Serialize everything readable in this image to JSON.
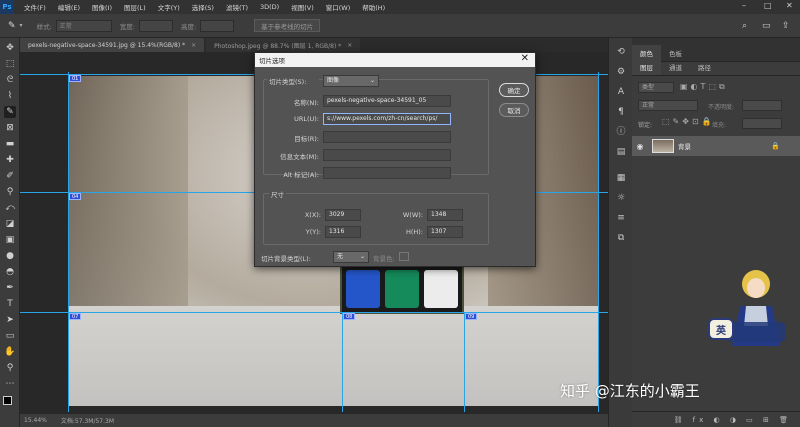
{
  "menubar": {
    "items": [
      "文件(F)",
      "编辑(E)",
      "图像(I)",
      "图层(L)",
      "文字(Y)",
      "选择(S)",
      "滤镜(T)",
      "3D(D)",
      "视图(V)",
      "窗口(W)",
      "帮助(H)"
    ],
    "logo": "Ps"
  },
  "optionsbar": {
    "style_label": "样式:",
    "style_value": "正常",
    "width_label": "宽度:",
    "height_label": "高度:",
    "guide_button": "基于参考线的切片"
  },
  "tabs": [
    {
      "label": "pexels-negative-space-34591.jpg @ 15.4%(RGB/8) *"
    },
    {
      "label": "Photoshop.jpeg @ 88.7% (图层 1, RGB/8) *"
    }
  ],
  "statusbar": {
    "zoom": "15.44%",
    "doc": "文档:57.3M/57.3M"
  },
  "slices": [
    "01",
    "04",
    "07",
    "08",
    "09"
  ],
  "panels": {
    "tabs_top": [
      "颜色",
      "色板"
    ],
    "tabs_layers": [
      "图层",
      "通道",
      "路径"
    ],
    "filter_placeholder": "类型",
    "blend_mode": "正常",
    "opacity_label": "不透明度:",
    "lock_label": "锁定:",
    "fill_label": "填充:",
    "layer_name": "背景"
  },
  "dialog": {
    "title": "切片选项",
    "slice_type_label": "切片类型(S):",
    "slice_type_value": "图像",
    "name_label": "名称(N):",
    "name_value": "pexels-negative-space-34591_05",
    "url_label": "URL(U):",
    "url_value": "s://www.pexels.com/zh-cn/search/ps/",
    "target_label": "目标(R):",
    "message_label": "信息文本(M):",
    "alt_label": "Alt 标记(A):",
    "dimensions_title": "尺寸",
    "x_label": "X(X):",
    "x_value": "3029",
    "y_label": "Y(Y):",
    "y_value": "1316",
    "w_label": "W(W):",
    "w_value": "1348",
    "h_label": "H(H):",
    "h_value": "1307",
    "bg_type_label": "切片背景类型(L):",
    "bg_type_value": "无",
    "bg_color_label": "背景色:",
    "ok_button": "确定",
    "cancel_button": "取消"
  },
  "watermark": "知乎 @江东的小霸王",
  "mascot_badge": "英"
}
